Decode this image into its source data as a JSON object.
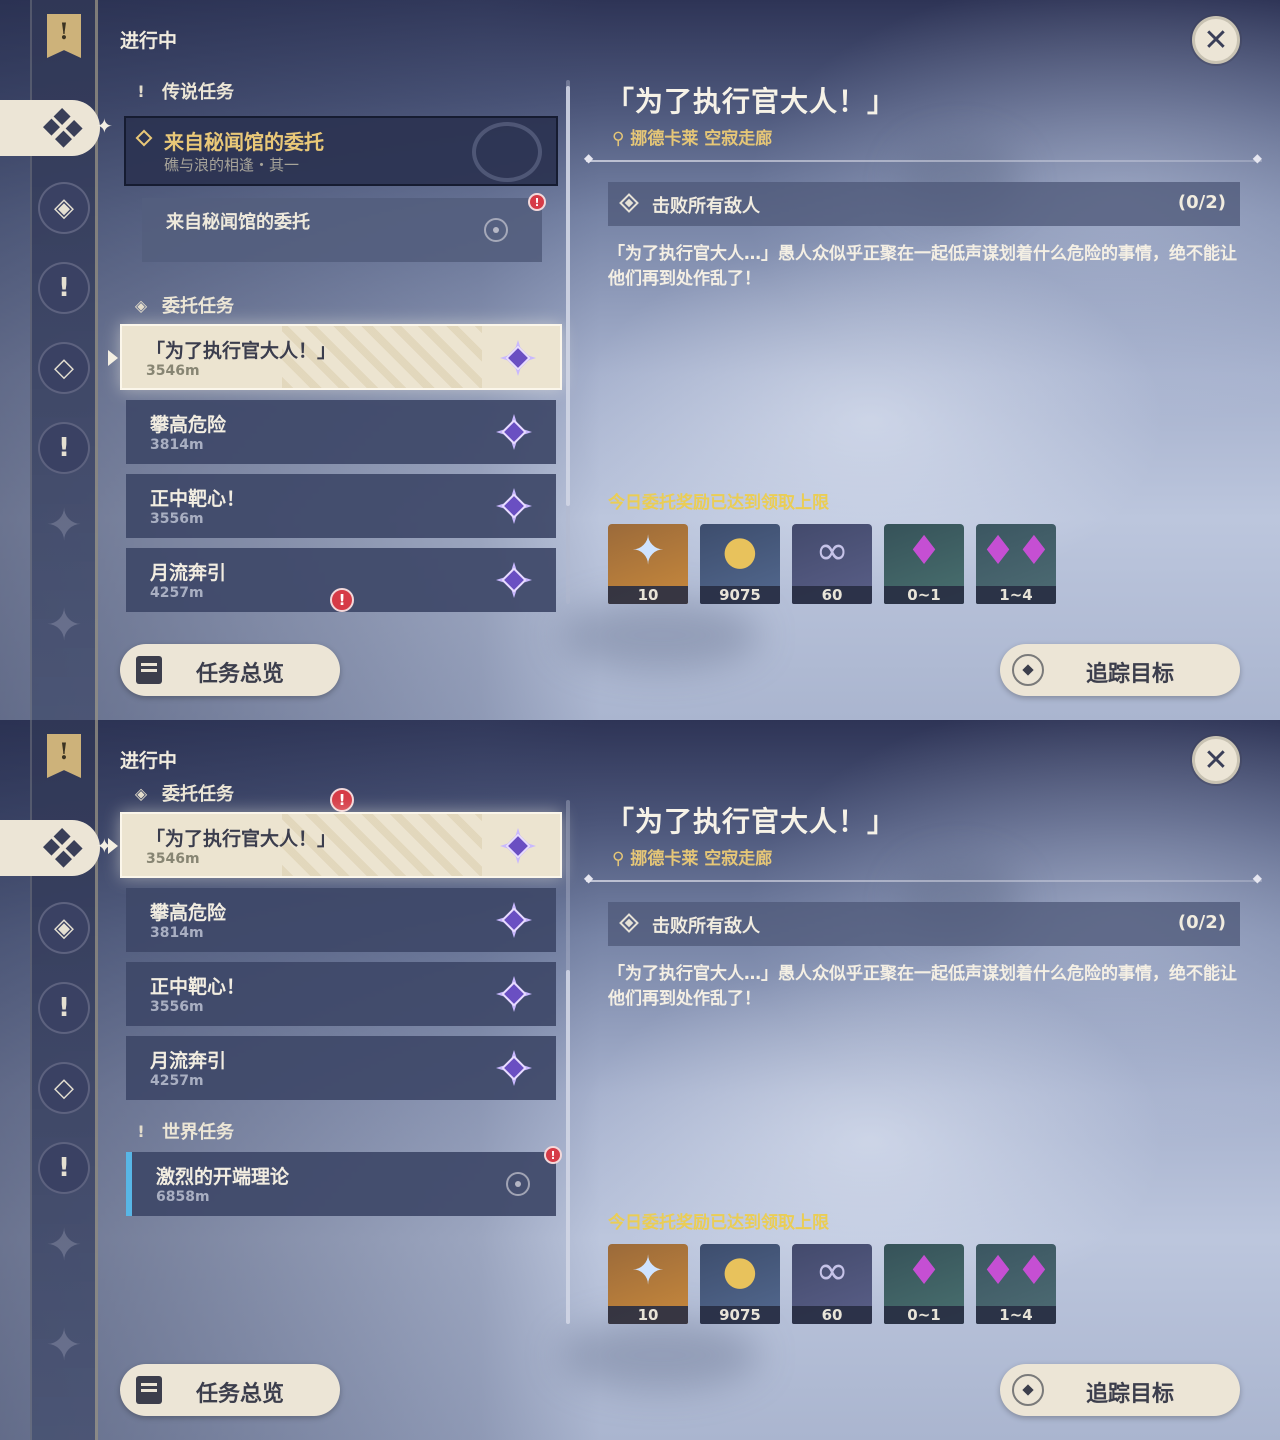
{
  "screens": [
    {
      "header": {
        "status_title": "进行中"
      },
      "sections": {
        "legend": {
          "title": "传说任务"
        },
        "commission": {
          "title": "委托任务"
        }
      },
      "legend_quest": {
        "name": "来自秘闻馆的委托",
        "subtitle": "礁与浪的相逢・其一"
      },
      "legend_subquest": {
        "name": "来自秘闻馆的委托"
      },
      "commissions": [
        {
          "name": "「为了执行官大人！」",
          "distance": "3546m"
        },
        {
          "name": "攀高危险",
          "distance": "3814m"
        },
        {
          "name": "正中靶心！",
          "distance": "3556m"
        },
        {
          "name": "月流奔引",
          "distance": "4257m"
        }
      ],
      "detail": {
        "title": "「为了执行官大人！」",
        "location": "挪德卡莱 空寂走廊",
        "objective": "击败所有敌人",
        "progress": "(0/2)",
        "description": "「为了执行官大人…」愚人众似乎正聚在一起低声谋划着什么危险的事情，绝不能让他们再到处作乱了！",
        "reward_note": "今日委托奖励已达到领取上限",
        "rewards": [
          {
            "icon": "primogem-icon",
            "qty": "10"
          },
          {
            "icon": "mora-icon",
            "qty": "9075"
          },
          {
            "icon": "adventure-exp-icon",
            "qty": "60"
          },
          {
            "icon": "crystal-icon",
            "qty": "0~1"
          },
          {
            "icon": "crystal-cluster-icon",
            "qty": "1~4"
          }
        ]
      },
      "buttons": {
        "overview": "任务总览",
        "track": "追踪目标"
      }
    },
    {
      "header": {
        "status_title": "进行中"
      },
      "sections": {
        "commission": {
          "title": "委托任务"
        },
        "world": {
          "title": "世界任务"
        }
      },
      "commissions": [
        {
          "name": "「为了执行官大人！」",
          "distance": "3546m"
        },
        {
          "name": "攀高危险",
          "distance": "3814m"
        },
        {
          "name": "正中靶心！",
          "distance": "3556m"
        },
        {
          "name": "月流奔引",
          "distance": "4257m"
        }
      ],
      "world_quest": {
        "name": "激烈的开端理论",
        "distance": "6858m"
      },
      "detail": {
        "title": "「为了执行官大人！」",
        "location": "挪德卡莱 空寂走廊",
        "objective": "击败所有敌人",
        "progress": "(0/2)",
        "description": "「为了执行官大人…」愚人众似乎正聚在一起低声谋划着什么危险的事情，绝不能让他们再到处作乱了！",
        "reward_note": "今日委托奖励已达到领取上限",
        "rewards": [
          {
            "icon": "primogem-icon",
            "qty": "10"
          },
          {
            "icon": "mora-icon",
            "qty": "9075"
          },
          {
            "icon": "adventure-exp-icon",
            "qty": "60"
          },
          {
            "icon": "crystal-icon",
            "qty": "0~1"
          },
          {
            "icon": "crystal-cluster-icon",
            "qty": "1~4"
          }
        ]
      },
      "buttons": {
        "overview": "任务总览",
        "track": "追踪目标"
      }
    }
  ],
  "colors": {
    "accent_gold": "#e9c878",
    "reward_note_yellow": "#eacd55",
    "selected_card": "#ece4d0",
    "world_quest_bar": "#58b6e6",
    "alert_red": "#d63b47"
  }
}
